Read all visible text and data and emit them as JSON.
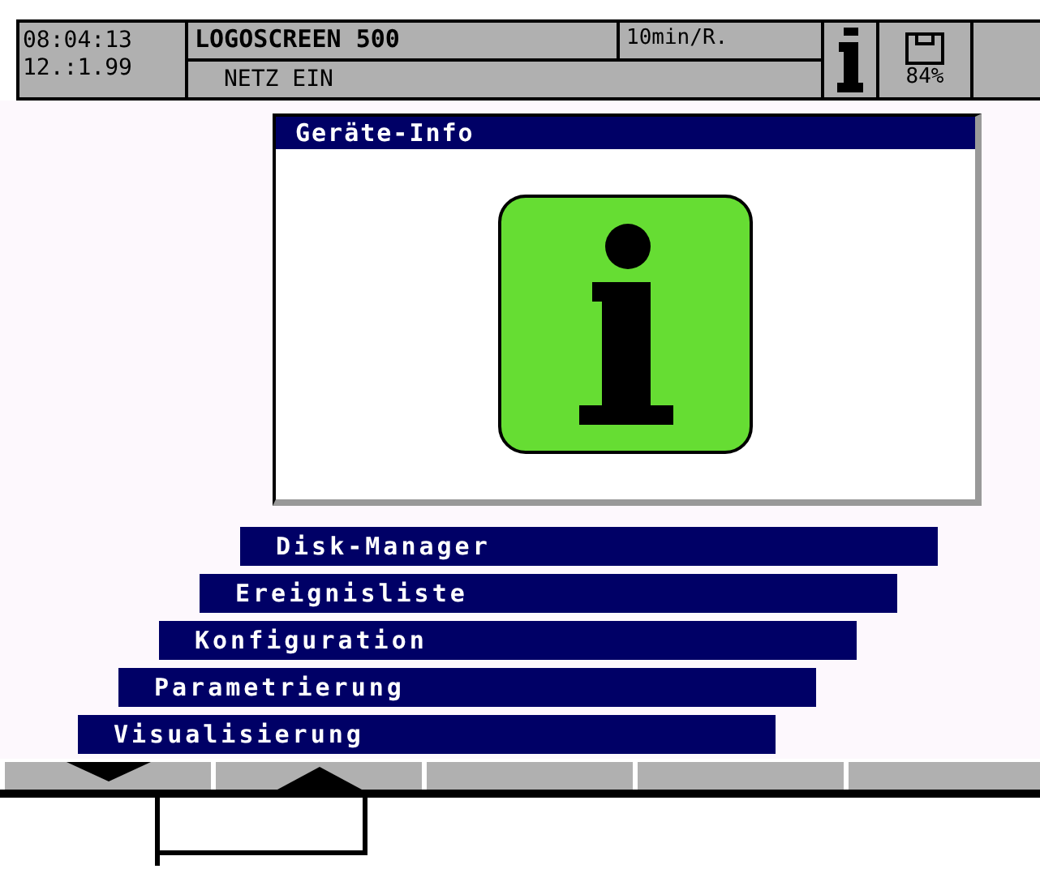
{
  "status_bar": {
    "time": "08:04:13",
    "date": "12.:1.99",
    "device_title": "LOGOSCREEN 500",
    "speed": "10min/R.",
    "message": "NETZ EIN",
    "disk_level_text": "84%"
  },
  "dialog": {
    "title": "Geräte-Info"
  },
  "menu": [
    {
      "label": "Disk-Manager"
    },
    {
      "label": "Ereignisliste"
    },
    {
      "label": "Konfiguration"
    },
    {
      "label": "Parametrierung"
    },
    {
      "label": "Visualisierung"
    }
  ],
  "softkeys": [
    {
      "kind": "down"
    },
    {
      "kind": "up"
    },
    {
      "kind": "blank"
    },
    {
      "kind": "blank"
    },
    {
      "kind": "blank"
    }
  ]
}
